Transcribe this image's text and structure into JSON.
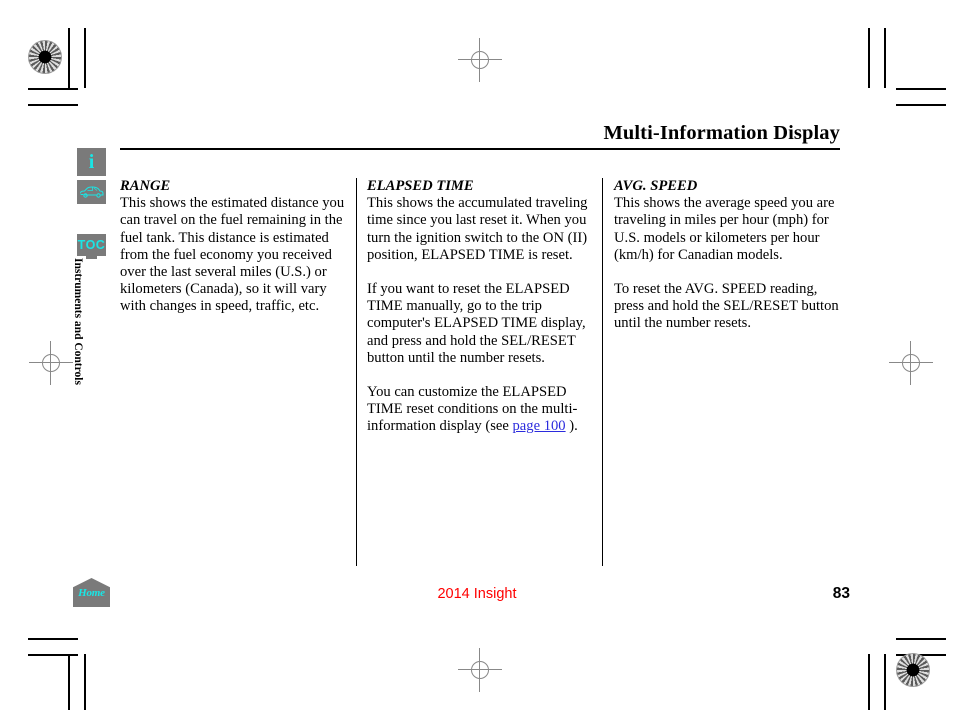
{
  "header": {
    "title": "Multi-Information Display"
  },
  "rail": {
    "info_icon_glyph": "i",
    "info_icon_name": "info-icon",
    "vehicle_icon_name": "car-icon",
    "toc_label": "TOC",
    "section_label": "Instruments and Controls"
  },
  "columns": [
    {
      "heading": "RANGE",
      "paragraphs": [
        "This shows the estimated distance you can travel on the fuel remaining in the fuel tank. This distance is estimated from the fuel economy you received over the last several miles (U.S.) or kilometers (Canada), so it will vary with changes in speed, traffic, etc."
      ]
    },
    {
      "heading": "ELAPSED TIME",
      "paragraphs": [
        "This shows the accumulated traveling time since you last reset it. When you turn the ignition switch to the ON (II) position, ELAPSED TIME is reset.",
        "If you want to reset the ELAPSED TIME manually, go to the trip computer's ELAPSED TIME display, and press and hold the SEL/RESET button until the number resets."
      ],
      "link_paragraph": {
        "before": "You can customize the ELAPSED TIME reset conditions on the multi-information display (see ",
        "link_text": "page 100",
        "after": " )."
      }
    },
    {
      "heading": "AVG. SPEED",
      "paragraphs": [
        "This shows the average speed you are traveling in miles per hour (mph) for U.S. models or kilometers per hour (km/h) for Canadian models.",
        "To reset the AVG. SPEED reading, press and hold the SEL/RESET button until the number resets."
      ]
    }
  ],
  "footer": {
    "home_label": "Home",
    "model": "2014 Insight",
    "page_number": "83"
  },
  "colors": {
    "icon_background": "#7a7a7a",
    "icon_foreground": "#19e6e6",
    "link": "#2b2bdd",
    "model_text": "#ff0000",
    "body_text": "#000000"
  }
}
